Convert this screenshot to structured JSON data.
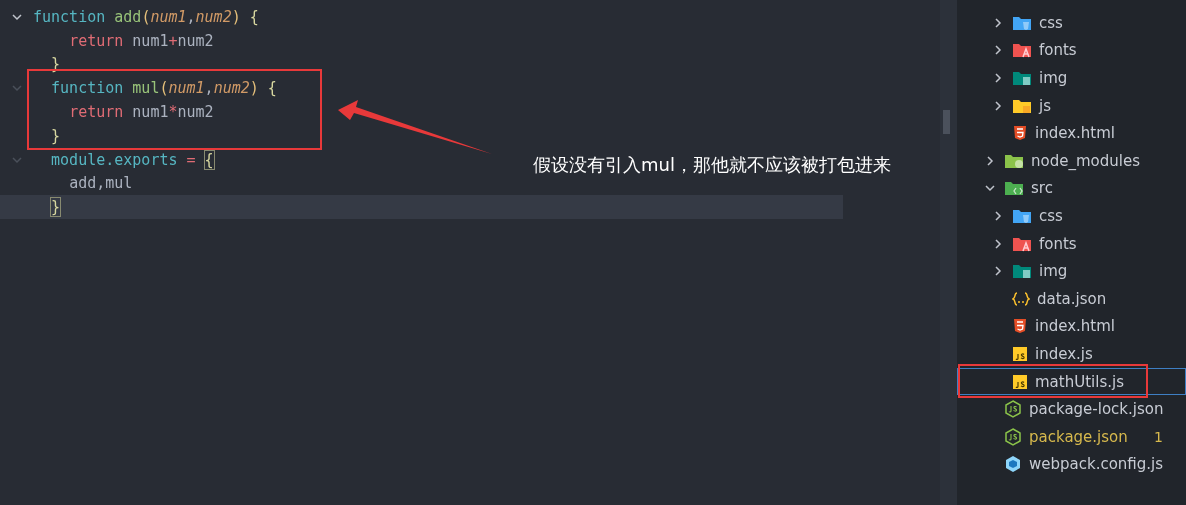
{
  "editor": {
    "lines": [
      {
        "foldable": true,
        "current": false,
        "tokens": [
          {
            "kind": "keyword",
            "text": "function "
          },
          {
            "kind": "func",
            "text": "add"
          },
          {
            "kind": "paren",
            "text": "("
          },
          {
            "kind": "param",
            "text": "num1"
          },
          {
            "kind": "punct",
            "text": ","
          },
          {
            "kind": "param",
            "text": "num2"
          },
          {
            "kind": "paren",
            "text": ") "
          },
          {
            "kind": "brace",
            "text": "{"
          }
        ]
      },
      {
        "foldable": false,
        "current": false,
        "tokens": [
          {
            "kind": "return",
            "text": "    return "
          },
          {
            "kind": "ident",
            "text": "num1"
          },
          {
            "kind": "op",
            "text": "+"
          },
          {
            "kind": "ident",
            "text": "num2"
          }
        ]
      },
      {
        "foldable": false,
        "current": false,
        "tokens": [
          {
            "kind": "brace",
            "text": "  }"
          }
        ]
      },
      {
        "foldable": true,
        "current": false,
        "tokens": [
          {
            "kind": "keyword",
            "text": "  function "
          },
          {
            "kind": "func",
            "text": "mul"
          },
          {
            "kind": "paren",
            "text": "("
          },
          {
            "kind": "param",
            "text": "num1"
          },
          {
            "kind": "punct",
            "text": ","
          },
          {
            "kind": "param",
            "text": "num2"
          },
          {
            "kind": "paren",
            "text": ") "
          },
          {
            "kind": "brace",
            "text": "{"
          }
        ]
      },
      {
        "foldable": false,
        "current": false,
        "tokens": [
          {
            "kind": "return",
            "text": "    return "
          },
          {
            "kind": "ident",
            "text": "num1"
          },
          {
            "kind": "op",
            "text": "*"
          },
          {
            "kind": "ident",
            "text": "num2"
          }
        ]
      },
      {
        "foldable": false,
        "current": false,
        "tokens": [
          {
            "kind": "brace",
            "text": "  }"
          }
        ]
      },
      {
        "foldable": true,
        "current": false,
        "tokens": [
          {
            "kind": "keyword",
            "text": "  module.exports "
          },
          {
            "kind": "op",
            "text": "= "
          },
          {
            "kind": "match",
            "text": "{"
          }
        ]
      },
      {
        "foldable": false,
        "current": false,
        "tokens": [
          {
            "kind": "ident",
            "text": "    add,mul"
          }
        ]
      },
      {
        "foldable": false,
        "current": true,
        "tokens": [
          {
            "kind": "match",
            "text": "  }"
          }
        ]
      }
    ]
  },
  "annotation": {
    "text": "假设没有引入mul，那他就不应该被打包进来"
  },
  "explorer": {
    "continued_children": [
      {
        "name": "css",
        "kind": "stylesheets",
        "expanded": false,
        "selected": false,
        "warning": false
      },
      {
        "name": "fonts",
        "kind": "fonts",
        "expanded": false,
        "selected": false,
        "warning": false
      },
      {
        "name": "img",
        "kind": "images",
        "expanded": false,
        "selected": false,
        "warning": false
      },
      {
        "name": "js",
        "kind": "scripts",
        "expanded": false,
        "selected": false,
        "warning": false
      },
      {
        "name": "index.html",
        "kind": "html",
        "selected": false,
        "warning": false
      }
    ],
    "items": [
      {
        "name": "node_modules",
        "kind": "modules",
        "expanded": false,
        "selected": false,
        "warning": false
      },
      {
        "name": "src",
        "kind": "source",
        "expanded": true,
        "selected": false,
        "warning": false,
        "children": [
          {
            "name": "css",
            "kind": "stylesheets",
            "expanded": false,
            "selected": false,
            "warning": false
          },
          {
            "name": "fonts",
            "kind": "fonts",
            "expanded": false,
            "selected": false,
            "warning": false
          },
          {
            "name": "img",
            "kind": "images",
            "expanded": false,
            "selected": false,
            "warning": false
          },
          {
            "name": "data.json",
            "kind": "json",
            "selected": false,
            "warning": false
          },
          {
            "name": "index.html",
            "kind": "html",
            "selected": false,
            "warning": false
          },
          {
            "name": "index.js",
            "kind": "javascript",
            "selected": false,
            "warning": false
          },
          {
            "name": "mathUtils.js",
            "kind": "javascript",
            "selected": true,
            "warning": false
          }
        ]
      },
      {
        "name": "package-lock.json",
        "kind": "node",
        "selected": false,
        "warning": false
      },
      {
        "name": "package.json",
        "kind": "node",
        "selected": false,
        "warning": true,
        "badge": "1"
      },
      {
        "name": "webpack.config.js",
        "kind": "webpack",
        "selected": false,
        "warning": false
      }
    ]
  }
}
